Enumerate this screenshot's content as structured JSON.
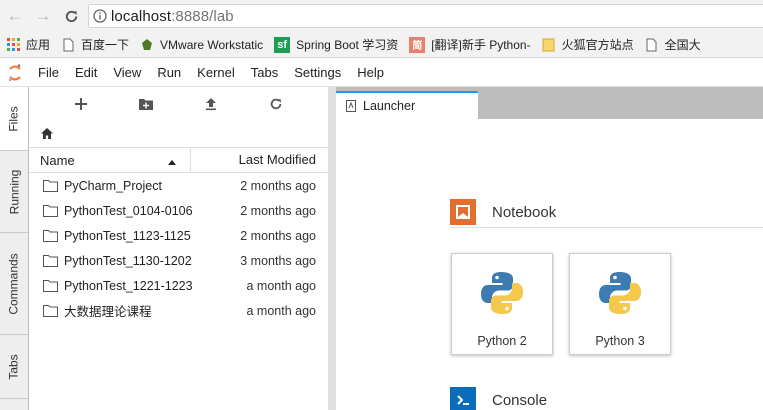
{
  "browser": {
    "url_host": "localhost",
    "url_rest": ":8888/lab",
    "bookmarks": [
      {
        "label": "应用",
        "icon": "apps-grid-icon",
        "color": "#e84d3c"
      },
      {
        "label": "百度一下",
        "icon": "page-icon",
        "color": "#555555"
      },
      {
        "label": "VMware Workstatic",
        "icon": "vmware-icon",
        "color": "#4e7a27"
      },
      {
        "label": "Spring Boot 学习资",
        "icon": "sf-icon",
        "color": "#1f9d55"
      },
      {
        "label": "[翻译]新手 Python-",
        "icon": "jian-icon",
        "color": "#e8816b"
      },
      {
        "label": "火狐官方站点",
        "icon": "folder-icon",
        "color": "#f5c542"
      },
      {
        "label": "全国大",
        "icon": "page-icon",
        "color": "#555555"
      }
    ]
  },
  "menubar": {
    "items": [
      "File",
      "Edit",
      "View",
      "Run",
      "Kernel",
      "Tabs",
      "Settings",
      "Help"
    ]
  },
  "sidebar": {
    "tabs": [
      "Files",
      "Running",
      "Commands",
      "Tabs"
    ]
  },
  "filebrowser": {
    "col_name": "Name",
    "col_modified": "Last Modified",
    "files": [
      {
        "name": "PyCharm_Project",
        "modified": "2 months ago"
      },
      {
        "name": "PythonTest_0104-0106",
        "modified": "2 months ago"
      },
      {
        "name": "PythonTest_1123-1125",
        "modified": "2 months ago"
      },
      {
        "name": "PythonTest_1130-1202",
        "modified": "3 months ago"
      },
      {
        "name": "PythonTest_1221-1223",
        "modified": "a month ago"
      },
      {
        "name": "大数据理论课程",
        "modified": "a month ago"
      }
    ]
  },
  "main": {
    "tab_label": "Launcher",
    "notebook_title": "Notebook",
    "console_title": "Console",
    "kernels": [
      "Python 2",
      "Python 3"
    ],
    "accent_color": "#2196f3",
    "notebook_color": "#e46e2e",
    "console_color": "#0a6bb8"
  }
}
